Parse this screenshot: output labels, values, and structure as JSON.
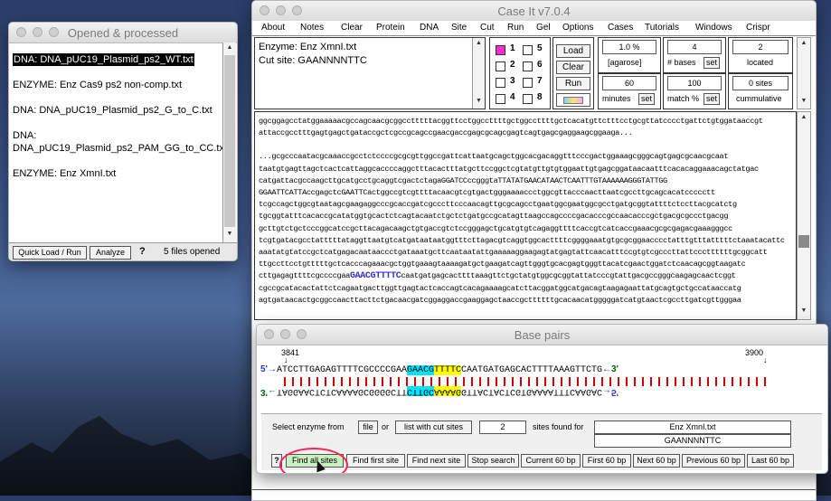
{
  "win1": {
    "title": "Opened & processed",
    "items": [
      "DNA: DNA_pUC19_Plasmid_ps2_WT.txt",
      "ENZYME: Enz Cas9 ps2 non-comp.txt",
      "DNA: DNA_pUC19_Plasmid_ps2_G_to_C.txt",
      "DNA:",
      "DNA_pUC19_Plasmid_ps2_PAM_GG_to_CC.txt",
      "ENZYME: Enz XmnI.txt"
    ],
    "quick_load": "Quick Load / Run",
    "analyze": "Analyze",
    "help": "?",
    "files_opened": "5  files opened"
  },
  "main": {
    "title": "Case It v7.0.4",
    "menu": [
      "About",
      "Notes",
      "Clear",
      "Protein",
      "DNA",
      "Site",
      "Cut",
      "Run",
      "Gel",
      "Options",
      "Cases",
      "Tutorials",
      "Windows",
      "Crispr"
    ],
    "enzyme_line": "Enzyme: Enz XmnI.txt",
    "cutsite_line": "Cut site: GAANNNNTTC",
    "lanes": [
      "1",
      "2",
      "3",
      "4",
      "5",
      "6",
      "7",
      "8"
    ],
    "load": "Load",
    "clear": "Clear",
    "run": "Run",
    "agarose_val": "1.0 %",
    "agarose_lbl": "[agarose]",
    "bases_val": "4",
    "bases_lbl": "# bases",
    "set": "set",
    "located_val": "2",
    "located_lbl": "located",
    "minutes_val": "60",
    "minutes_lbl": "minutes",
    "match_val": "100",
    "match_lbl": "match %",
    "cum_val": "0  sites",
    "cum_lbl": "cummulative",
    "seq_top": [
      "ggcggagcctatggaaaaacgccagcaacgcggcctttttacggttcctggccttttgctggccttttgctcacatgttctttcctgcgttatcccctgattctgtggataaccgt",
      "attaccgcctttgagtgagctgataccgctcgccgcagccgaacgaccgagcgcagcgagtcagtgagcgaggaagcggaaga..."
    ],
    "seq_gap": "",
    "seq_body": [
      "...gcgcccaatacgcaaaccgcctctccccgcgcgttggccgattcattaatgcagctggcacgacaggtttcccgactggaaagcgggcagtgagcgcaacgcaat",
      "taatgtgagttagctcactcattaggcaccccaggctttacactttatgcttccggctcgtatgttgtgtggaattgtgagcggataacaatttcacacaggaaacagctatgac",
      "catgattacgccaagcttgcatgcctgcaggtcgactctagaGGATCCccgggtaTTATATGAACATAACTCAATTTGTAAAAAAGGGTATTGG",
      "GGAATTCATTAccgagctcGAATTCactggccgtcgttttacaacgtcgtgactgggaaaaccctggcgttacccaacttaatcgccttgcagcacatccccctt",
      "tcgccagctggcgtaatagcgaagaggcccgcaccgatcgcccttcccaacagttgcgcagcctgaatggcgaatggcgcctgatgcggtattttctccttacgcatctg",
      "tgcggtatttcacaccgcatatggtgcactctcagtacaatctgctctgatgccgcatagttaagccagccccgacacccgccaacacccgctgacgcgccctgacgg",
      "gcttgtctgctcccggcatccgcttacagacaagctgtgaccgtctccgggagctgcatgtgtcagaggttttcaccgtcatcaccgaaacgcgcgagacgaaagggcc",
      "tcgtgatacgcctatttttataggttaatgtcatgataataatggtttcttagacgtcaggtggcacttttcggggaaatgtgcgcggaacccctatttgtttatttttctaaatacattc",
      "aaatatgtatccgctcatgagacaataaccctgataaatgcttcaataatattgaaaaaggaagagtatgagtattcaacatttccgtgtcgcccttattcccttttttgcggcatt",
      "ttgccttcctgtttttgctcacccagaaacgctggtgaaagtaaaagatgctgaagatcagttgggtgcacgagtgggttacatcgaactggatctcaacagcggtaagatc",
      "cttgagagttttcgccccgaa",
      "GAACGTTTTC",
      "caatgatgagcacttttaaagttctgctatgtggcgcggtattatcccgtattgacgccgggcaagagcaactcggt",
      "cgccgcatacactattctcagaatgacttggttgagtactcaccagtcacagaaaagcatcttacggatggcatgacagtaagagaattatgcagtgctgccataaccatg",
      "agtgataacactgcggccaacttacttctgacaacgatcggaggaccgaaggagctaaccgcttttttgcacaacatgggggatcatgtaactcgccttgatcgttgggaa"
    ]
  },
  "bp": {
    "title": "Base pairs",
    "start": "3841",
    "end": "3900",
    "top_prefix": "5'→",
    "top_pre": "ATCCTTGAGAGTTTTCGCCCCGAA",
    "top_cyan": "GAACG",
    "top_yellow": "TTTTC",
    "top_post": "CAATGATGAGCACTTTTAAAGTTCTG",
    "top_suffix": "←3'",
    "bot_prefix": "3'←",
    "bot_pre": "TAGGAACTCTCAAAAGCGGGGCTT",
    "bot_cyan": "CTTGC",
    "bot_yellow": "AAAAG",
    "bot_post": "GTTACTACTCGTGAAAATTTCAAGAC",
    "bot_suffix": "→5'",
    "select_label": "Select enzyme from",
    "file_btn": "file",
    "or_label": "or",
    "list_btn": "list with cut sites",
    "sites_count": "2",
    "sites_found": "sites found for",
    "enzyme_name": "Enz XmnI.txt",
    "enzyme_site": "GAANNNNTTC",
    "help": "?",
    "buttons": [
      "Find all sites",
      "Find first site",
      "Find next site",
      "Stop search",
      "Current 60 bp",
      "First 60 bp",
      "Next 60 bp",
      "Previous 60 bp",
      "Last 60 bp"
    ]
  },
  "colors": {
    "cyan": "#00e5ff",
    "yellow": "#ffff00",
    "blue": "#3333cc",
    "green": "#006600",
    "red": "#d00000",
    "highlight": "#ff2050"
  }
}
